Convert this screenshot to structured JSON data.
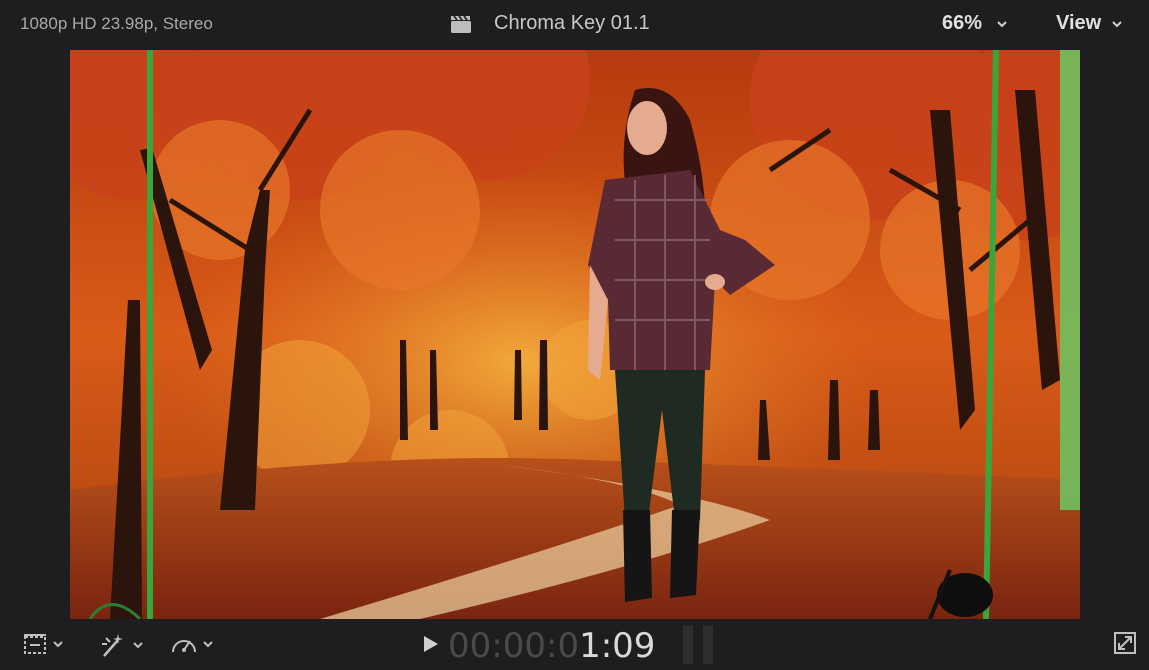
{
  "header": {
    "format_info": "1080p HD 23.98p, Stereo",
    "project_title": "Chroma Key 01.1",
    "zoom_value": "66%",
    "view_label": "View"
  },
  "footer": {
    "timecode_dim": "00:00:0",
    "timecode_bright": "1:09"
  },
  "icons": {
    "clapper": "clapperboard-icon",
    "transform": "transform-tool-icon",
    "enhance": "magic-wand-icon",
    "speed": "speedometer-icon",
    "play": "play-icon",
    "fullscreen": "fullscreen-icon"
  },
  "colors": {
    "background": "#1e1e20",
    "chroma_green": "#3aa53a",
    "foliage_orange": "#d2561a"
  }
}
